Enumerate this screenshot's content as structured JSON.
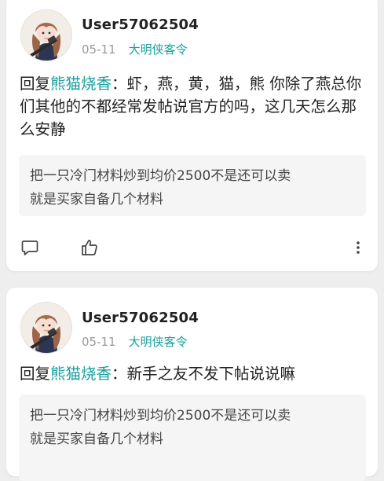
{
  "posts": [
    {
      "username": "User57062504",
      "date": "05-11",
      "section": "大明侠客令",
      "reply_prefix": "回复",
      "mention": "熊猫烧香",
      "body": "：虾，燕，黄，猫，熊 你除了燕总你们其他的不都经常发帖说官方的吗，这几天怎么那么安静",
      "quote_lines": [
        "把一只冷门材料炒到均价2500不是还可以卖",
        "就是买家自备几个材料"
      ]
    },
    {
      "username": "User57062504",
      "date": "05-11",
      "section": "大明侠客令",
      "reply_prefix": "回复",
      "mention": "熊猫烧香",
      "body": "：新手之友不发下帖说说嘛",
      "quote_lines": [
        "把一只冷门材料炒到均价2500不是还可以卖",
        "就是买家自备几个材料"
      ]
    }
  ],
  "icons": {
    "comment": "comment-icon",
    "like": "thumbs-up-icon",
    "more": "more-vertical-icon"
  },
  "colors": {
    "accent": "#1a9e9e",
    "background": "#eeeeee",
    "card": "#ffffff",
    "quote_bg": "#f5f5f5"
  }
}
